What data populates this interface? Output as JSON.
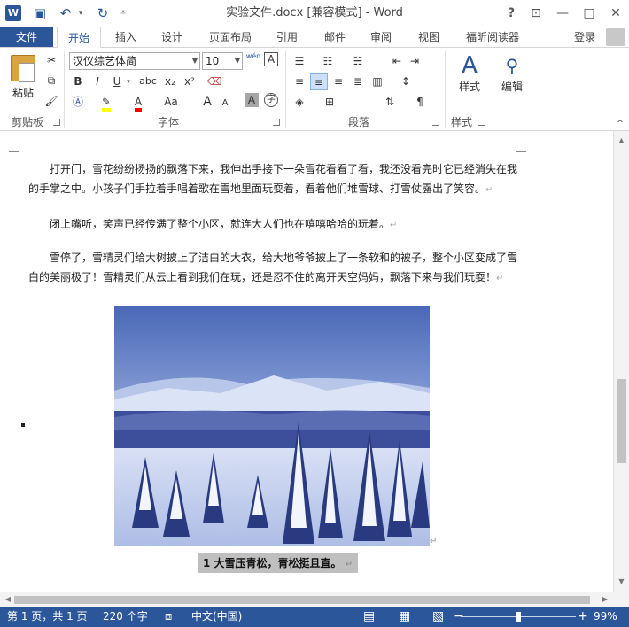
{
  "app": {
    "window_title": "实验文件.docx [兼容模式] - Word",
    "logo": "W",
    "login": "登录"
  },
  "quick_access": {
    "save_icon": "save-icon",
    "undo_icon": "undo-icon",
    "redo_icon": "redo-icon"
  },
  "window_controls": {
    "help": "?",
    "ribbon_options": "⊡",
    "minimize": "—",
    "maximize": "□",
    "close": "✕"
  },
  "tabs": [
    {
      "label": "文件"
    },
    {
      "label": "开始"
    },
    {
      "label": "插入"
    },
    {
      "label": "设计"
    },
    {
      "label": "页面布局"
    },
    {
      "label": "引用"
    },
    {
      "label": "邮件"
    },
    {
      "label": "审阅"
    },
    {
      "label": "视图"
    },
    {
      "label": "福昕阅读器"
    }
  ],
  "ribbon": {
    "clipboard": {
      "label": "剪贴板",
      "paste": "粘贴"
    },
    "font": {
      "label": "字体",
      "font_name": "汉仪综艺体简",
      "font_size": "10",
      "bold": "B",
      "italic": "I",
      "underline": "U",
      "strike": "abc",
      "subscript": "x₂",
      "superscript": "x²",
      "change_case": "Aa",
      "grow": "A",
      "shrink": "A",
      "phonetic": "wén",
      "char_border": "A",
      "char_shading": "A",
      "enclose": "字"
    },
    "paragraph": {
      "label": "段落"
    },
    "styles": {
      "label": "样式",
      "button": "样式"
    },
    "editing": {
      "button": "编辑"
    }
  },
  "document": {
    "paragraphs": [
      "打开门，雪花纷纷扬扬的飘落下来，我伸出手接下一朵雪花看看了看，我还没看完时它已经消失在我的手掌之中。小孩子们手拉着手唱着歌在雪地里面玩耍着，看着他们堆雪球、打雪仗露出了笑容。",
      "闭上嘴听，笑声已经传满了整个小区，就连大人们也在嘻嘻哈哈的玩着。",
      "雪停了，雪精灵们给大树披上了洁白的大衣，给大地爷爷披上了一条软和的被子，整个小区变成了雪白的美丽极了！雪精灵们从云上看到我们在玩，还是忍不住的离开天空妈妈，飘落下来与我们玩耍！"
    ],
    "paragraph_mark": "↵",
    "caption_number": "1",
    "caption_text": "大雪压青松，青松挺且直。"
  },
  "status_bar": {
    "page": "第 1 页，共 1 页",
    "words": "220 个字",
    "language": "中文(中国)",
    "zoom_minus": "−",
    "zoom_plus": "+",
    "zoom": "99%",
    "zoom_level": 0.5
  },
  "colors": {
    "accent": "#2b579a",
    "highlight": "#ffff00",
    "font_color": "#ff0000"
  }
}
